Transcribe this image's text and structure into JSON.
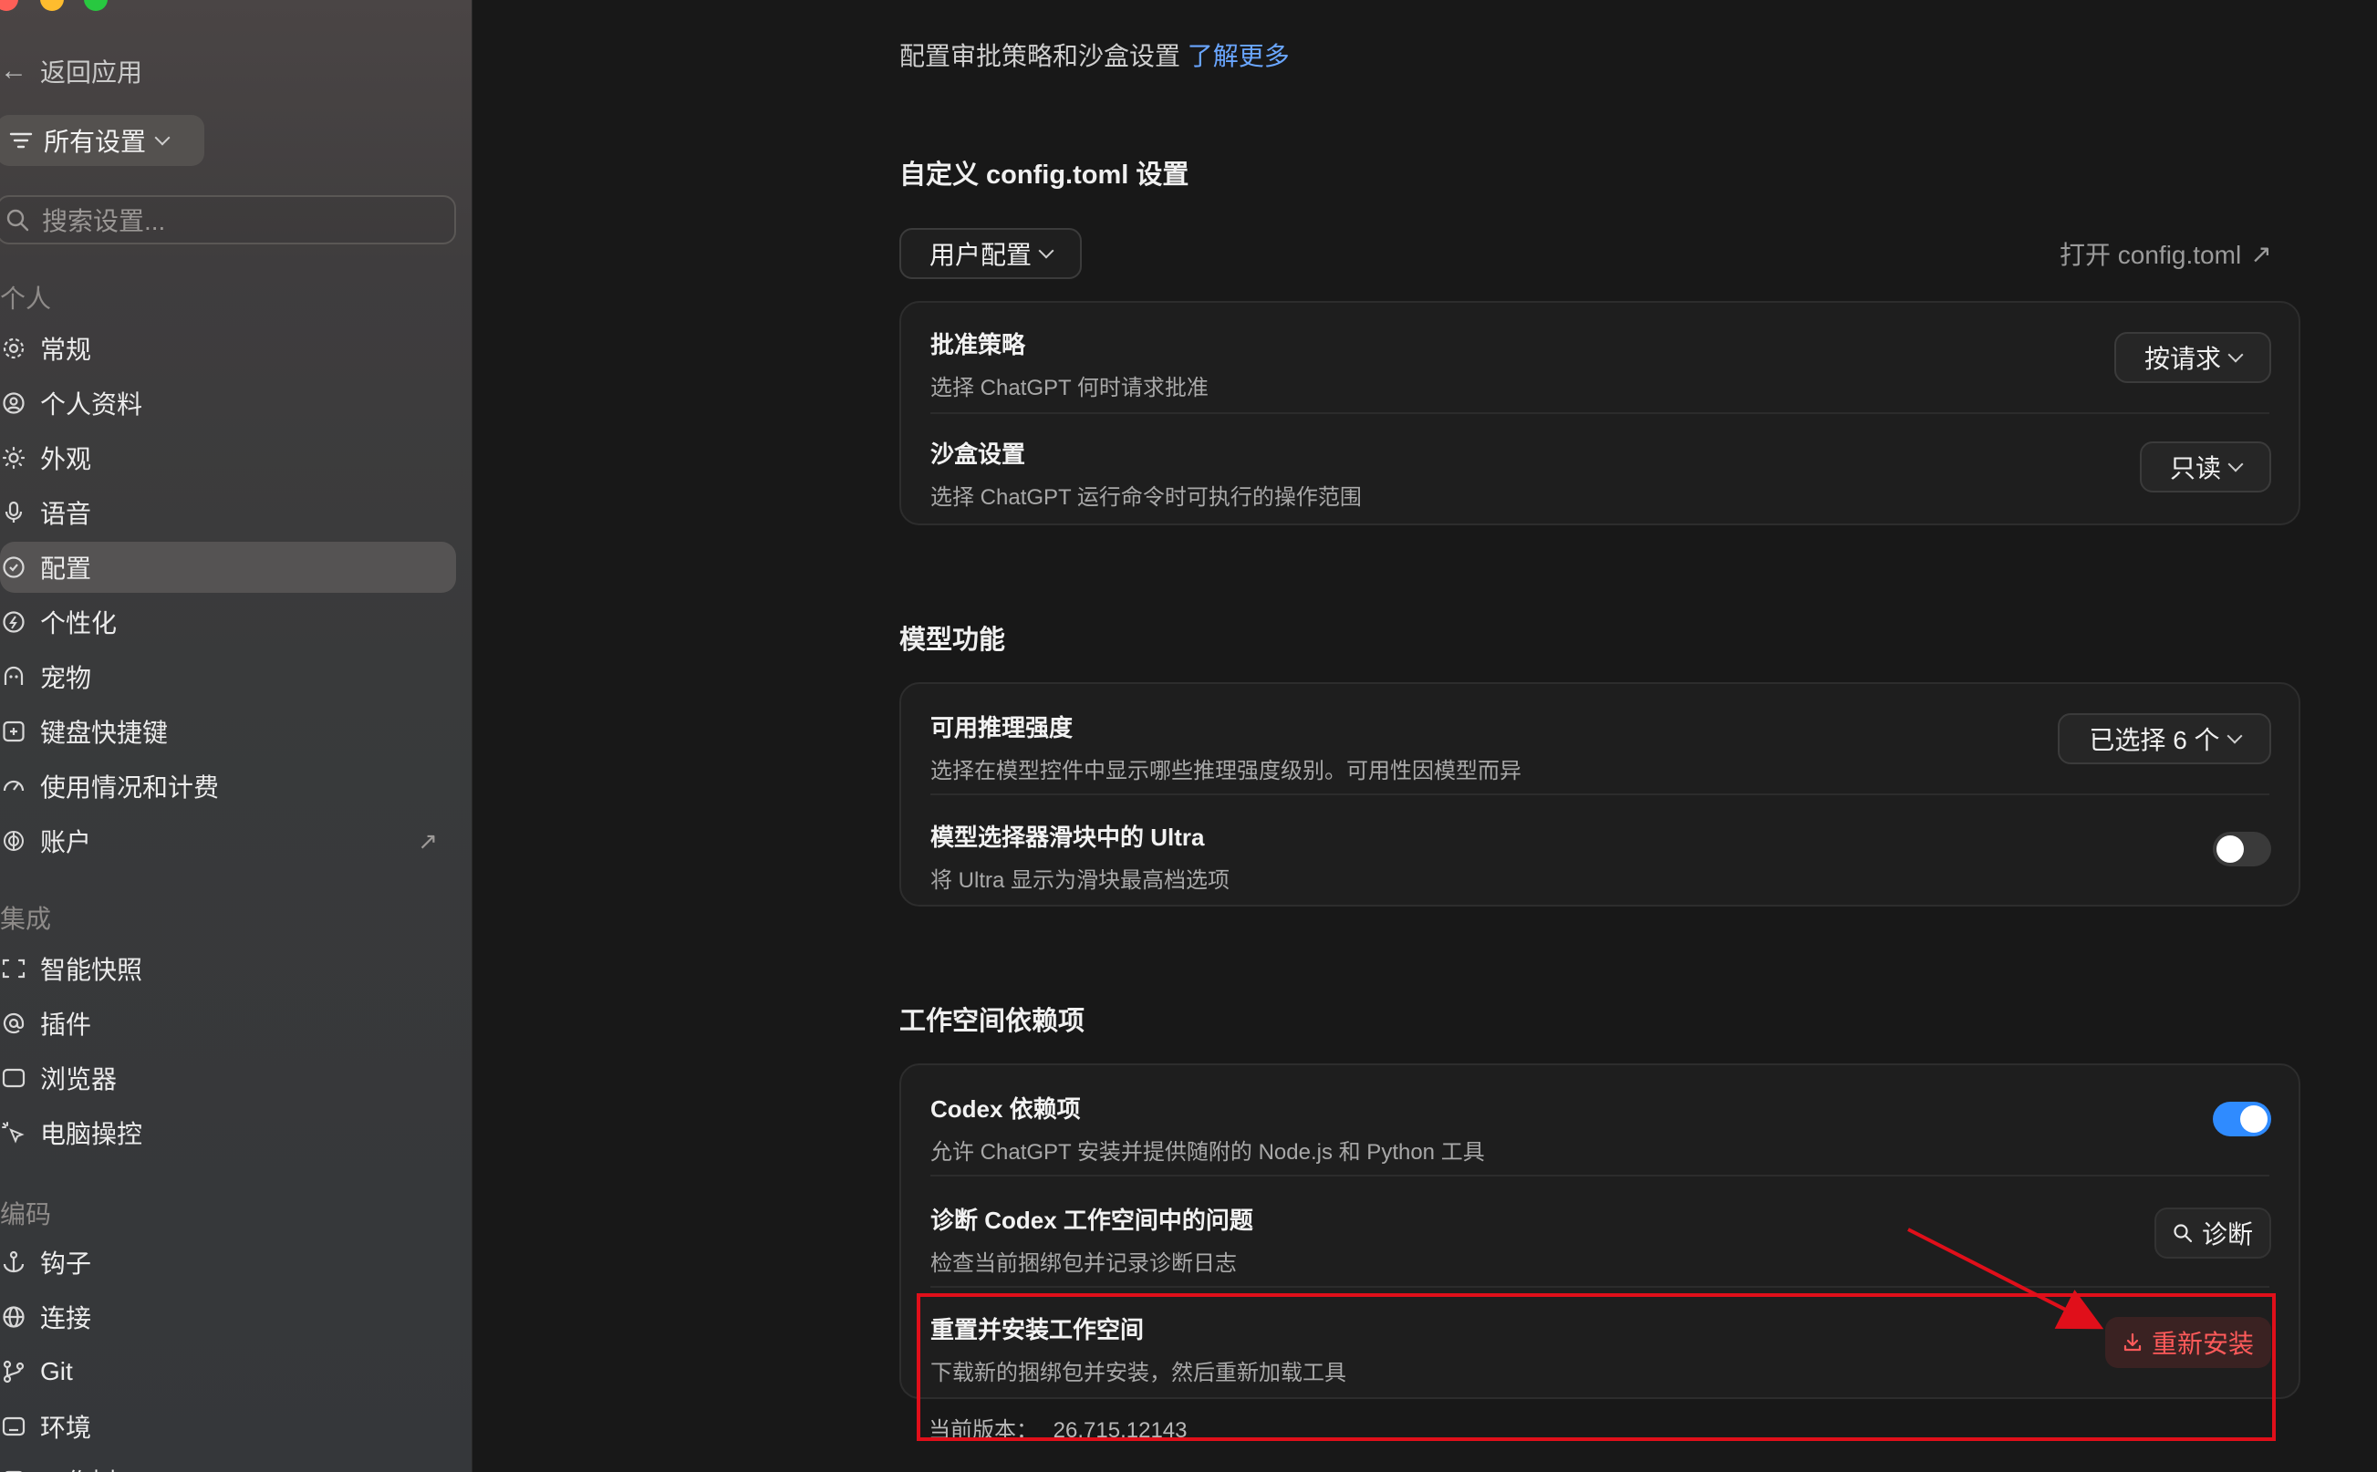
{
  "sidebar": {
    "back_label": "返回应用",
    "all_settings_label": "所有设置",
    "search_placeholder": "搜索设置...",
    "section_personal": "个人",
    "section_integrations": "集成",
    "section_coding": "编码",
    "items_personal": [
      {
        "label": "常规",
        "icon": "gear-icon"
      },
      {
        "label": "个人资料",
        "icon": "user-circle-icon"
      },
      {
        "label": "外观",
        "icon": "sun-icon"
      },
      {
        "label": "语音",
        "icon": "microphone-icon"
      },
      {
        "label": "配置",
        "icon": "shield-icon",
        "active": true
      },
      {
        "label": "个性化",
        "icon": "sparkle-circle-icon"
      },
      {
        "label": "宠物",
        "icon": "pet-icon"
      },
      {
        "label": "键盘快捷键",
        "icon": "keyboard-icon"
      },
      {
        "label": "使用情况和计费",
        "icon": "gauge-icon"
      },
      {
        "label": "账户",
        "icon": "openai-icon",
        "external": true
      }
    ],
    "items_integrations": [
      {
        "label": "智能快照",
        "icon": "screenshot-icon"
      },
      {
        "label": "插件",
        "icon": "at-icon"
      },
      {
        "label": "浏览器",
        "icon": "browser-icon"
      },
      {
        "label": "电脑操控",
        "icon": "cursor-click-icon"
      }
    ],
    "items_coding": [
      {
        "label": "钩子",
        "icon": "anchor-icon"
      },
      {
        "label": "连接",
        "icon": "globe-icon"
      },
      {
        "label": "Git",
        "icon": "git-branch-icon"
      },
      {
        "label": "环境",
        "icon": "terminal-icon"
      },
      {
        "label": "工作树",
        "icon": "tree-icon"
      }
    ]
  },
  "main": {
    "intro_text": "配置审批策略和沙盒设置",
    "intro_link": "了解更多",
    "config_section": {
      "title": "自定义 config.toml 设置",
      "scope_dropdown": "用户配置",
      "open_link": "打开 config.toml",
      "rows": [
        {
          "title": "批准策略",
          "desc": "选择 ChatGPT 何时请求批准",
          "control": "按请求"
        },
        {
          "title": "沙盒设置",
          "desc": "选择 ChatGPT 运行命令时可执行的操作范围",
          "control": "只读"
        }
      ]
    },
    "model_section": {
      "title": "模型功能",
      "rows": [
        {
          "title": "可用推理强度",
          "desc": "选择在模型控件中显示哪些推理强度级别。可用性因模型而异",
          "control": "已选择 6 个"
        },
        {
          "title": "模型选择器滑块中的 Ultra",
          "desc": "将 Ultra 显示为滑块最高档选项",
          "toggle": "off"
        }
      ]
    },
    "workspace_section": {
      "title": "工作空间依赖项",
      "rows": [
        {
          "title": "Codex 依赖项",
          "desc": "允许 ChatGPT 安装并提供随附的 Node.js 和 Python 工具",
          "toggle": "on"
        },
        {
          "title": "诊断 Codex 工作空间中的问题",
          "desc": "检查当前捆绑包并记录诊断日志",
          "control": "诊断"
        },
        {
          "title": "重置并安装工作空间",
          "desc": "下载新的捆绑包并安装，然后重新加载工具",
          "control": "重新安装"
        }
      ],
      "version_label": "当前版本：",
      "version_value": "26.715.12143"
    }
  },
  "colors": {
    "accent": "#2f8bff",
    "link": "#6aa6ff",
    "danger": "#ff5a5a",
    "highlight": "#e00f1a"
  }
}
